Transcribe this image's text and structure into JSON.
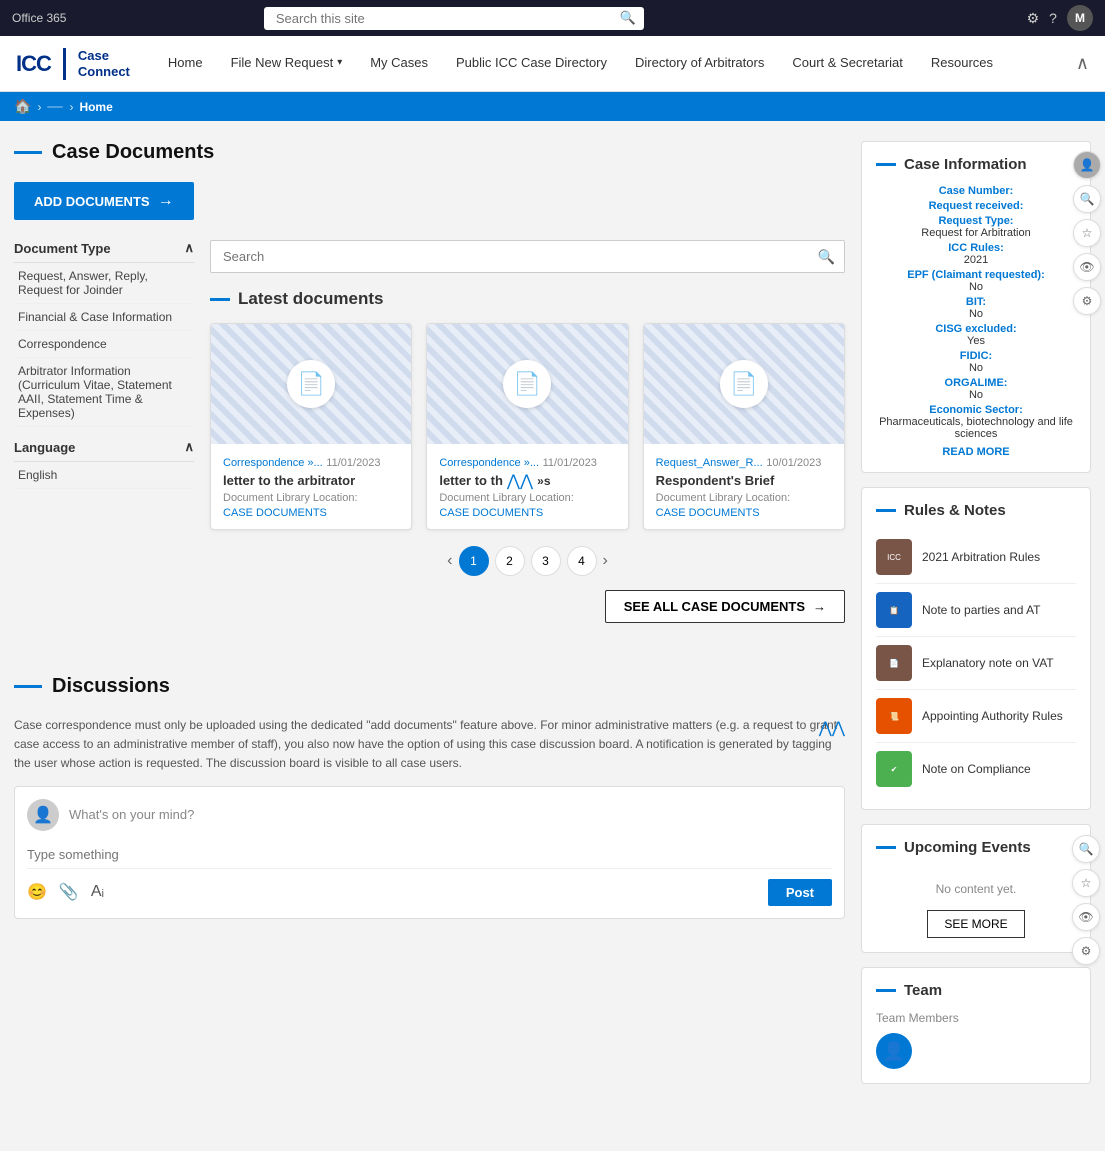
{
  "topbar": {
    "title": "Office 365",
    "search_placeholder": "Search this site",
    "settings_icon": "⚙",
    "help_icon": "?",
    "avatar_label": "M"
  },
  "nav": {
    "logo_icc": "ICC",
    "logo_text_line1": "Case",
    "logo_text_line2": "Connect",
    "links": [
      {
        "label": "Home",
        "has_dropdown": false
      },
      {
        "label": "File New Request",
        "has_dropdown": true
      },
      {
        "label": "My Cases",
        "has_dropdown": false
      },
      {
        "label": "Public ICC Case Directory",
        "has_dropdown": false
      },
      {
        "label": "Directory of Arbitrators",
        "has_dropdown": false
      },
      {
        "label": "Court & Secretariat",
        "has_dropdown": false
      },
      {
        "label": "Resources",
        "has_dropdown": false
      }
    ]
  },
  "breadcrumb": {
    "home_icon": "🏠",
    "items": [
      {
        "label": "",
        "is_pill": true
      },
      {
        "label": "Home",
        "is_active": true
      }
    ]
  },
  "case_documents": {
    "section_title": "Case Documents",
    "add_button": "ADD DOCUMENTS",
    "search_placeholder": "Search",
    "latest_docs_title": "Latest documents",
    "document_types": {
      "label": "Document Type",
      "items": [
        "Request, Answer, Reply, Request for Joinder",
        "Financial & Case Information",
        "Correspondence",
        "Arbitrator Information (Curriculum Vitae, Statement AAII, Statement Time & Expenses)"
      ]
    },
    "language": {
      "label": "Language",
      "items": [
        "English"
      ]
    },
    "documents": [
      {
        "type": "Correspondence »...",
        "date": "11/01/2023",
        "title": "letter to the arbitrator",
        "location_label": "Document Library Location:",
        "location_link": "CASE DOCUMENTS"
      },
      {
        "type": "Correspondence »...",
        "date": "11/01/2023",
        "title": "letter to th",
        "location_label": "Document Library Location:",
        "location_link": "CASE DOCUMENTS"
      },
      {
        "type": "Request_Answer_R...",
        "date": "10/01/2023",
        "title": "Respondent's Brief",
        "location_label": "Document Library Location:",
        "location_link": "CASE DOCUMENTS"
      }
    ],
    "pagination": {
      "pages": [
        "1",
        "2",
        "3",
        "4"
      ],
      "active": 0
    },
    "see_all_label": "SEE ALL CASE DOCUMENTS"
  },
  "discussions": {
    "section_title": "Discussions",
    "description": "Case correspondence must only be uploaded using the dedicated \"add documents\" feature above. For minor administrative matters (e.g. a request to grant case access to an administrative member of staff), you also now have the option of using this case discussion board. A notification is generated by tagging the user whose action is requested. The discussion board is visible to all case users.",
    "comment_prompt": "What's on your mind?",
    "comment_placeholder": "Type something",
    "post_button": "Post"
  },
  "case_information": {
    "section_title": "Case Information",
    "fields": [
      {
        "label": "Case Number:",
        "value": ""
      },
      {
        "label": "Request received:",
        "value": ""
      },
      {
        "label": "Request Type:",
        "value": "Request for Arbitration"
      },
      {
        "label": "ICC Rules:",
        "value": "2021"
      },
      {
        "label": "EPF (Claimant requested):",
        "value": "No"
      },
      {
        "label": "BIT:",
        "value": "No"
      },
      {
        "label": "CISG excluded:",
        "value": "Yes"
      },
      {
        "label": "FIDIC:",
        "value": "No"
      },
      {
        "label": "ORGALIME:",
        "value": "No"
      },
      {
        "label": "Economic Sector:",
        "value": "Pharmaceuticals, biotechnology and life sciences"
      }
    ],
    "read_more": "READ MORE"
  },
  "rules_notes": {
    "section_title": "Rules & Notes",
    "items": [
      {
        "label": "2021 Arbitration Rules",
        "color": "brown"
      },
      {
        "label": "Note to parties and AT",
        "color": "blue"
      },
      {
        "label": "Explanatory note on VAT",
        "color": "brown"
      },
      {
        "label": "Appointing Authority Rules",
        "color": "orange"
      },
      {
        "label": "Note on Compliance",
        "color": "green"
      }
    ]
  },
  "upcoming_events": {
    "section_title": "Upcoming Events",
    "no_content": "No content yet.",
    "see_more": "SEE MORE"
  },
  "team": {
    "section_title": "Team",
    "members_label": "Team Members"
  },
  "floating_icons": {
    "user": "👤",
    "search": "🔍",
    "star": "☆",
    "eye": "👁",
    "settings": "⚙"
  }
}
